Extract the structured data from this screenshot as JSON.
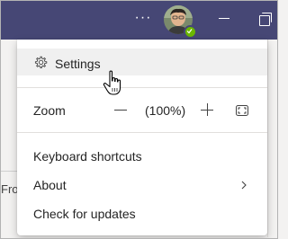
{
  "titlebar": {
    "more_label": "···",
    "background": "#464775"
  },
  "background_window": {
    "partial_text": "Fro"
  },
  "menu": {
    "settings": {
      "label": "Settings",
      "icon": "gear-icon"
    },
    "zoom": {
      "label": "Zoom",
      "decrease_icon": "minus-icon",
      "level": "(100%)",
      "increase_icon": "plus-icon",
      "fullscreen_icon": "fullscreen-icon"
    },
    "items": [
      {
        "label": "Keyboard shortcuts"
      },
      {
        "label": "About",
        "icon": "chevron-right-icon"
      },
      {
        "label": "Check for updates"
      }
    ]
  },
  "status_color": "#6bb700"
}
